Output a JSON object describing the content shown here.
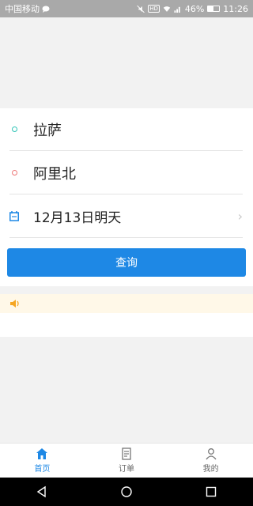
{
  "status_bar": {
    "carrier": "中国移动",
    "battery": "46%",
    "time": "11:26",
    "hd_label": "HD"
  },
  "search_form": {
    "from_city": "拉萨",
    "to_city": "阿里北",
    "date": "12月13日明天",
    "query_button": "查询"
  },
  "tabs": [
    {
      "label": "首页",
      "icon": "home-icon",
      "active": true
    },
    {
      "label": "订单",
      "icon": "order-icon",
      "active": false
    },
    {
      "label": "我的",
      "icon": "user-icon",
      "active": false
    }
  ],
  "colors": {
    "primary": "#1e88e5",
    "from_dot": "#2ec4b6",
    "to_dot": "#ee7a7a",
    "notice_bg": "#fff8e8",
    "speaker": "#f5a623"
  }
}
